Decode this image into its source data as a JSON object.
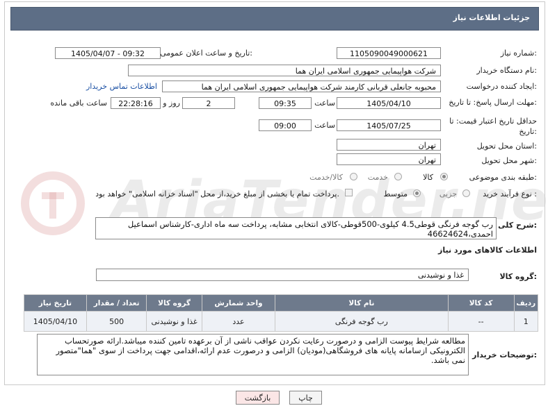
{
  "header": {
    "title": "جزئیات اطلاعات نیاز"
  },
  "fields": {
    "need_number_label": "شماره نیاز:",
    "need_number": "1105090049000621",
    "announce_label": "تاریخ و ساعت اعلان عمومی:",
    "announce_value": "1405/04/07 - 09:32",
    "buyer_org_label": "نام دستگاه خریدار:",
    "buyer_org": "شرکت هواپیمایی جمهوری اسلامی ایران هما",
    "creator_label": "ایجاد کننده درخواست:",
    "creator": "محبوبه جانعلی قربانی کارمند شرکت هواپیمایی جمهوری اسلامی ایران هما",
    "contact_link": "اطلاعات تماس خریدار",
    "reply_deadline_label": "مهلت ارسال پاسخ: تا تاریخ:",
    "reply_date": "1405/04/10",
    "time_label": "ساعت",
    "reply_time": "09:35",
    "days_value": "2",
    "days_label": "روز و",
    "remaining_time": "22:28:16",
    "remaining_label": "ساعت باقی مانده",
    "min_validity_label": "حداقل تاریخ اعتبار قیمت: تا تاریخ:",
    "validity_date": "1405/07/25",
    "validity_time_label": "ساعت",
    "validity_time": "09:00",
    "province_label": "استان محل تحویل:",
    "province": "تهران",
    "city_label": "شهر محل تحویل:",
    "city": "تهران",
    "category_label": "طبقه بندی موضوعی:",
    "category_options": [
      "کالا",
      "خدمت",
      "کالا/خدمت"
    ],
    "process_label": "نوع فرآیند خرید :",
    "process_options": [
      "جزیی",
      "متوسط"
    ],
    "payment_note": "پرداخت تمام یا بخشی از مبلغ خرید،از محل \"اسناد خزانه اسلامی\" خواهد بود."
  },
  "description": {
    "label": "شرح کلی نیاز:",
    "text": "رب گوجه فرنگی قوطی4.5 کیلوی-500قوطی-کالای انتخابی مشابه، پرداخت سه ماه اداری-کارشناس اسماعیل احمدی،46624624"
  },
  "goods_section": {
    "title": "اطلاعات کالاهای مورد نیاز",
    "group_label": "گروه کالا:",
    "group_value": "غذا و نوشیدنی"
  },
  "table": {
    "headers": [
      "ردیف",
      "کد کالا",
      "نام کالا",
      "واحد شمارش",
      "گروه کالا",
      "تعداد / مقدار",
      "تاریخ نیاز"
    ],
    "rows": [
      [
        "1",
        "--",
        "رب گوجه فرنگی",
        "عدد",
        "غذا و نوشیدنی",
        "500",
        "1405/04/10"
      ]
    ]
  },
  "buyer_notes": {
    "label": "توضیحات خریدار:",
    "text": "مطالعه شرایط پیوست الزامی و درصورت رعایت نکردن عواقب ناشی از آن برعهده تامین کننده میباشد.ارائه صورتحساب الکترونیکی ازسامانه پایانه های فروشگاهی(مودیان) الزامی و درصورت عدم ارائه،اقدامی جهت پرداخت از سوی \"هما\"متصور نمی باشد."
  },
  "buttons": {
    "print": "چاپ",
    "back": "بازگشت"
  },
  "watermark": {
    "text": "AriaTender.net"
  }
}
